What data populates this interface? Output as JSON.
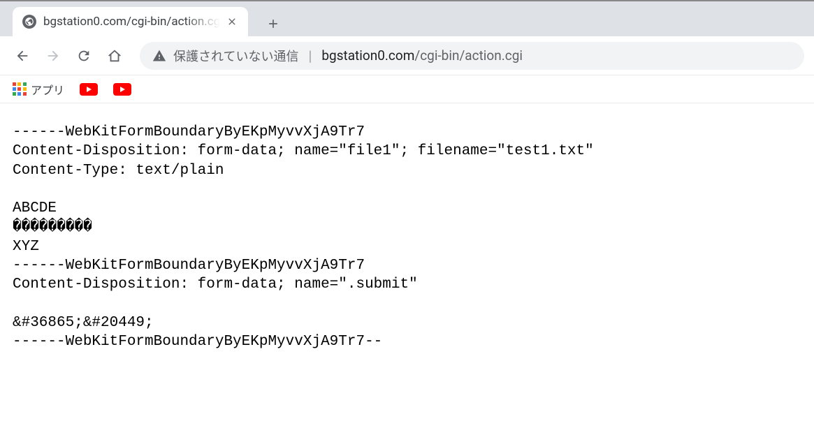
{
  "tab": {
    "title": "bgstation0.com/cgi-bin/action.cg"
  },
  "address": {
    "security_text": "保護されていない通信",
    "host": "bgstation0.com",
    "path": "/cgi-bin/action.cgi"
  },
  "bookmarks": {
    "apps_label": "アプリ"
  },
  "content": {
    "line1": "------WebKitFormBoundaryByEKpMyvvXjA9Tr7",
    "line2": "Content-Disposition: form-data; name=\"file1\"; filename=\"test1.txt\"",
    "line3": "Content-Type: text/plain",
    "line4": "",
    "line5": "ABCDE",
    "line6": "���������",
    "line7": "XYZ",
    "line8": "------WebKitFormBoundaryByEKpMyvvXjA9Tr7",
    "line9": "Content-Disposition: form-data; name=\".submit\"",
    "line10": "",
    "line11": "&#36865;&#20449;",
    "line12": "------WebKitFormBoundaryByEKpMyvvXjA9Tr7--"
  }
}
